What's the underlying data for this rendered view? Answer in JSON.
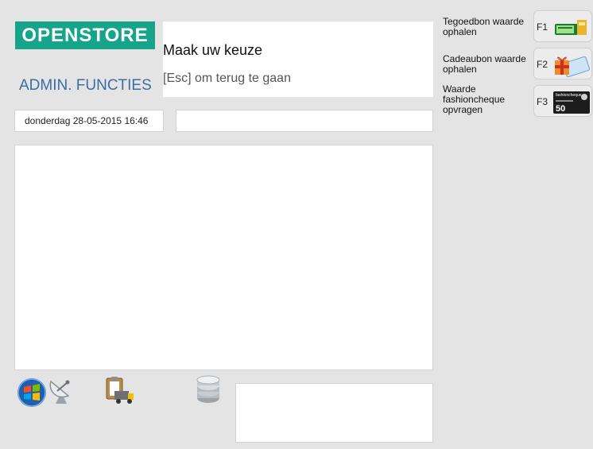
{
  "header": {
    "logo_text": "OPENSTORE",
    "section_title": "ADMIN. FUNCTIES"
  },
  "prompt": {
    "title": "Maak uw keuze",
    "hint": "[Esc] om terug te gaan"
  },
  "status": {
    "datetime": "donderdag 28-05-2015 16:46"
  },
  "functions": [
    {
      "key": "F1",
      "label": "Tegoedbon waarde ophalen",
      "icon": "cash-register-icon"
    },
    {
      "key": "F2",
      "label": "Cadeaubon waarde ophalen",
      "icon": "gift-card-icon"
    },
    {
      "key": "F3",
      "label": "Waarde fashioncheque opvragen",
      "icon": "fashioncheque-card-icon"
    }
  ],
  "fashioncheque_card": {
    "brand": "fashioncheque",
    "amount": "50"
  },
  "taskbar": {
    "icons": [
      "windows-start-icon",
      "satellite-dish-icon",
      "clipboard-truck-icon",
      "database-icon"
    ]
  },
  "colors": {
    "logo_bg": "#16a58a",
    "section_title": "#3a6ea5"
  }
}
